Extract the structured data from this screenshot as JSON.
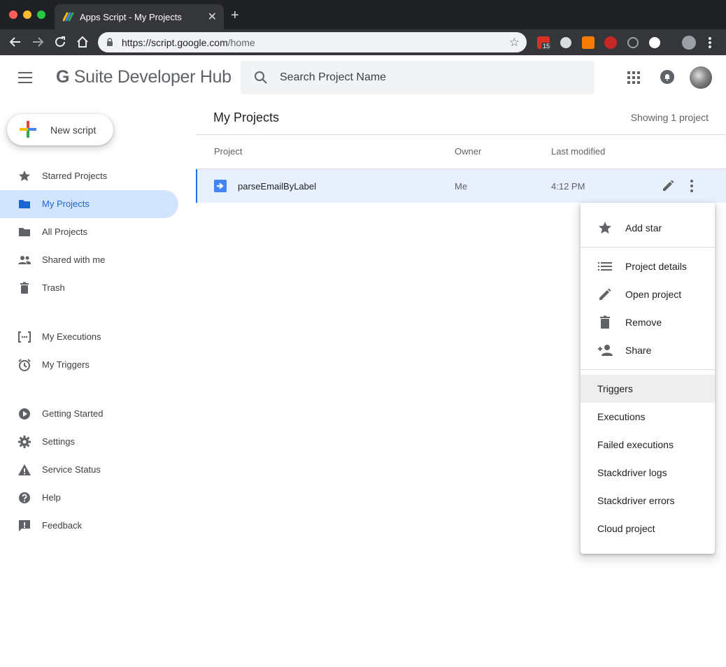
{
  "browser": {
    "tab_title": "Apps Script - My Projects",
    "tab_close": "✕",
    "new_tab": "+",
    "url_host": "https://script.google.com",
    "url_path": "/home",
    "extension_badge": "15"
  },
  "header": {
    "brand_prefix": "G",
    "brand_rest": " Suite Developer Hub",
    "search_placeholder": "Search Project Name"
  },
  "sidebar": {
    "new_script_label": "New script",
    "items": [
      {
        "label": "Starred Projects",
        "icon": "star-icon"
      },
      {
        "label": "My Projects",
        "icon": "folder-icon",
        "active": true
      },
      {
        "label": "All Projects",
        "icon": "folder-icon"
      },
      {
        "label": "Shared with me",
        "icon": "people-icon"
      },
      {
        "label": "Trash",
        "icon": "trash-icon"
      },
      {
        "label": "My Executions",
        "icon": "executions-icon"
      },
      {
        "label": "My Triggers",
        "icon": "alarm-icon"
      },
      {
        "label": "Getting Started",
        "icon": "play-circle-icon"
      },
      {
        "label": "Settings",
        "icon": "gear-icon"
      },
      {
        "label": "Service Status",
        "icon": "warning-icon"
      },
      {
        "label": "Help",
        "icon": "help-icon"
      },
      {
        "label": "Feedback",
        "icon": "feedback-icon"
      }
    ]
  },
  "main": {
    "title": "My Projects",
    "showing": "Showing 1 project",
    "columns": {
      "project": "Project",
      "owner": "Owner",
      "last_modified": "Last modified"
    },
    "rows": [
      {
        "name": "parseEmailByLabel",
        "owner": "Me",
        "last_modified": "4:12 PM"
      }
    ]
  },
  "menu": {
    "items": [
      {
        "label": "Add star",
        "icon": "star-icon"
      },
      {
        "label": "Project details",
        "icon": "list-icon"
      },
      {
        "label": "Open project",
        "icon": "pencil-icon"
      },
      {
        "label": "Remove",
        "icon": "trash-icon"
      },
      {
        "label": "Share",
        "icon": "person-add-icon"
      },
      {
        "label": "Triggers"
      },
      {
        "label": "Executions"
      },
      {
        "label": "Failed executions"
      },
      {
        "label": "Stackdriver logs"
      },
      {
        "label": "Stackdriver errors"
      },
      {
        "label": "Cloud project"
      }
    ]
  },
  "colors": {
    "active_bg": "#d2e3fc",
    "active_text": "#1967d2",
    "row_highlight": "#e8f0fe",
    "accent_blue": "#4285f4",
    "hover_bg": "#eeeeee"
  }
}
